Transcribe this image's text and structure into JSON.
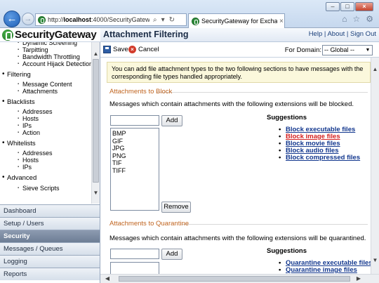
{
  "browser": {
    "url_prefix": "http://",
    "url_host": "localhost",
    "url_rest": ":4000/SecurityGateway.dll?vi",
    "search_icon": "search-icon",
    "tab_title": "SecurityGateway for Excha...",
    "tab_close": "×",
    "back_glyph": "←",
    "forward_glyph": "→",
    "minimize": "–",
    "maximize": "□",
    "close": "×"
  },
  "app": {
    "logo": "SecurityGateway",
    "page_title": "Attachment Filtering",
    "top_links": "Help | About | Sign Out"
  },
  "sidebar": {
    "tree": [
      {
        "kind": "sub",
        "label": "Dynamic Screening"
      },
      {
        "kind": "sub",
        "label": "Tarpitting"
      },
      {
        "kind": "sub",
        "label": "Bandwidth Throttling"
      },
      {
        "kind": "sub",
        "label": "Account Hijack Detection"
      },
      {
        "kind": "cat",
        "label": "Filtering"
      },
      {
        "kind": "sub",
        "label": "Message Content"
      },
      {
        "kind": "sub",
        "label": "Attachments"
      },
      {
        "kind": "cat",
        "label": "Blacklists"
      },
      {
        "kind": "sub",
        "label": "Addresses"
      },
      {
        "kind": "sub",
        "label": "Hosts"
      },
      {
        "kind": "sub",
        "label": "IPs"
      },
      {
        "kind": "sub",
        "label": "Action"
      },
      {
        "kind": "cat",
        "label": "Whitelists"
      },
      {
        "kind": "sub",
        "label": "Addresses"
      },
      {
        "kind": "sub",
        "label": "Hosts"
      },
      {
        "kind": "sub",
        "label": "IPs"
      },
      {
        "kind": "cat",
        "label": "Advanced"
      },
      {
        "kind": "sub",
        "label": "Sieve Scripts"
      }
    ],
    "sections": [
      "Dashboard",
      "Setup / Users",
      "Security",
      "Messages / Queues",
      "Logging",
      "Reports"
    ],
    "active_section": "Security"
  },
  "toolbar": {
    "save_label": "Save",
    "cancel_label": "Cancel",
    "domain_label": "For Domain:",
    "domain_value": "-- Global --"
  },
  "main": {
    "note": "You can add file attachment types to the two following sections to have messages with the corresponding file types handled appropriately.",
    "block": {
      "legend": "Attachments to Block",
      "description": "Messages which contain attachments with the following extensions will be blocked.",
      "add_label": "Add",
      "remove_label": "Remove",
      "extensions": [
        "BMP",
        "GIF",
        "JPG",
        "PNG",
        "TIF",
        "TIFF"
      ],
      "suggestions_title": "Suggestions",
      "suggestions": [
        "Block executable files",
        "Block image files",
        "Block movie files",
        "Block audio files",
        "Block compressed files"
      ]
    },
    "quarantine": {
      "legend": "Attachments to Quarantine",
      "description": "Messages which contain attachments with the following extensions will be quarantined.",
      "add_label": "Add",
      "suggestions_title": "Suggestions",
      "suggestions": [
        "Quarantine executable files",
        "Quarantine image files"
      ]
    }
  }
}
